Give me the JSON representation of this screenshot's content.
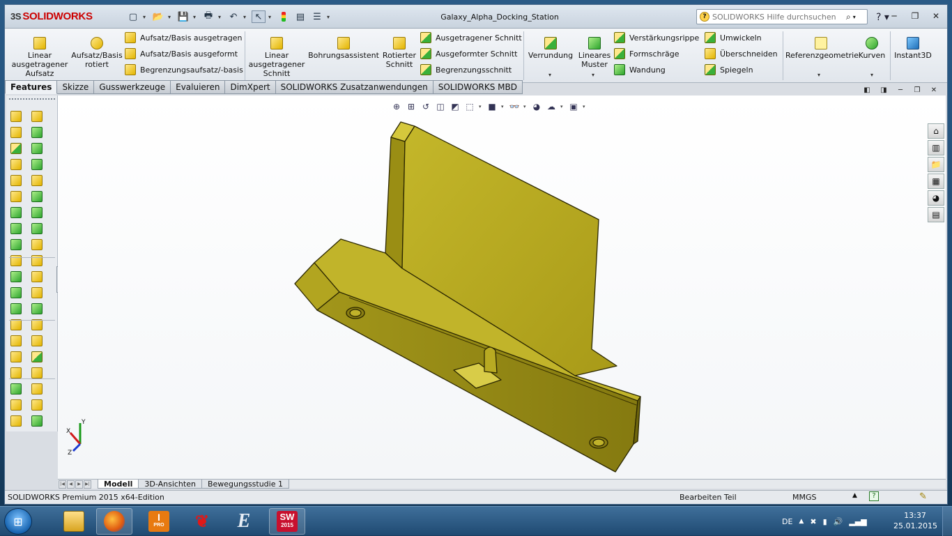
{
  "app": {
    "logo_text": "SOLIDWORKS",
    "document_title": "Galaxy_Alpha_Docking_Station",
    "help_search_placeholder": "SOLIDWORKS Hilfe durchsuchen"
  },
  "ribbon": {
    "linear_extruded_boss": "Linear ausgetragener Aufsatz",
    "revolved_boss": "Aufsatz/Basis rotiert",
    "swept_boss": "Aufsatz/Basis ausgetragen",
    "lofted_boss": "Aufsatz/Basis ausgeformt",
    "boundary_boss": "Begrenzungsaufsatz/-basis",
    "linear_extruded_cut": "Linear ausgetragener Schnitt",
    "hole_wizard": "Bohrungsassistent",
    "revolved_cut": "Rotierter Schnitt",
    "swept_cut": "Ausgetragener Schnitt",
    "lofted_cut": "Ausgeformter Schnitt",
    "boundary_cut": "Begrenzungsschnitt",
    "fillet": "Verrundung",
    "linear_pattern": "Lineares Muster",
    "rib": "Verstärkungsrippe",
    "draft": "Formschräge",
    "shell": "Wandung",
    "wrap": "Umwickeln",
    "intersect": "Überschneiden",
    "mirror": "Spiegeln",
    "reference_geometry": "Referenzgeometrie",
    "curves": "Kurven",
    "instant3d": "Instant3D"
  },
  "command_manager_tabs": [
    "Features",
    "Skizze",
    "Gusswerkzeuge",
    "Evaluieren",
    "DimXpert",
    "SOLIDWORKS Zusatzanwendungen",
    "SOLIDWORKS MBD"
  ],
  "bottom_tabs": [
    "Modell",
    "3D-Ansichten",
    "Bewegungsstudie 1"
  ],
  "status": {
    "edition": "SOLIDWORKS Premium 2015 x64-Edition",
    "mode": "Bearbeiten Teil",
    "units": "MMGS"
  },
  "triad": {
    "x": "X",
    "y": "Y",
    "z": "Z"
  },
  "taskbar": {
    "creo_label": "I",
    "creo_sub": "PRO",
    "sw_label": "SW",
    "sw_sub": "2015",
    "language": "DE",
    "time": "13:37",
    "date": "25.01.2015"
  },
  "colors": {
    "model_face": "#b5a81f",
    "model_top": "#c8bb2e",
    "model_side": "#8c8212",
    "accent": "#c00000"
  }
}
